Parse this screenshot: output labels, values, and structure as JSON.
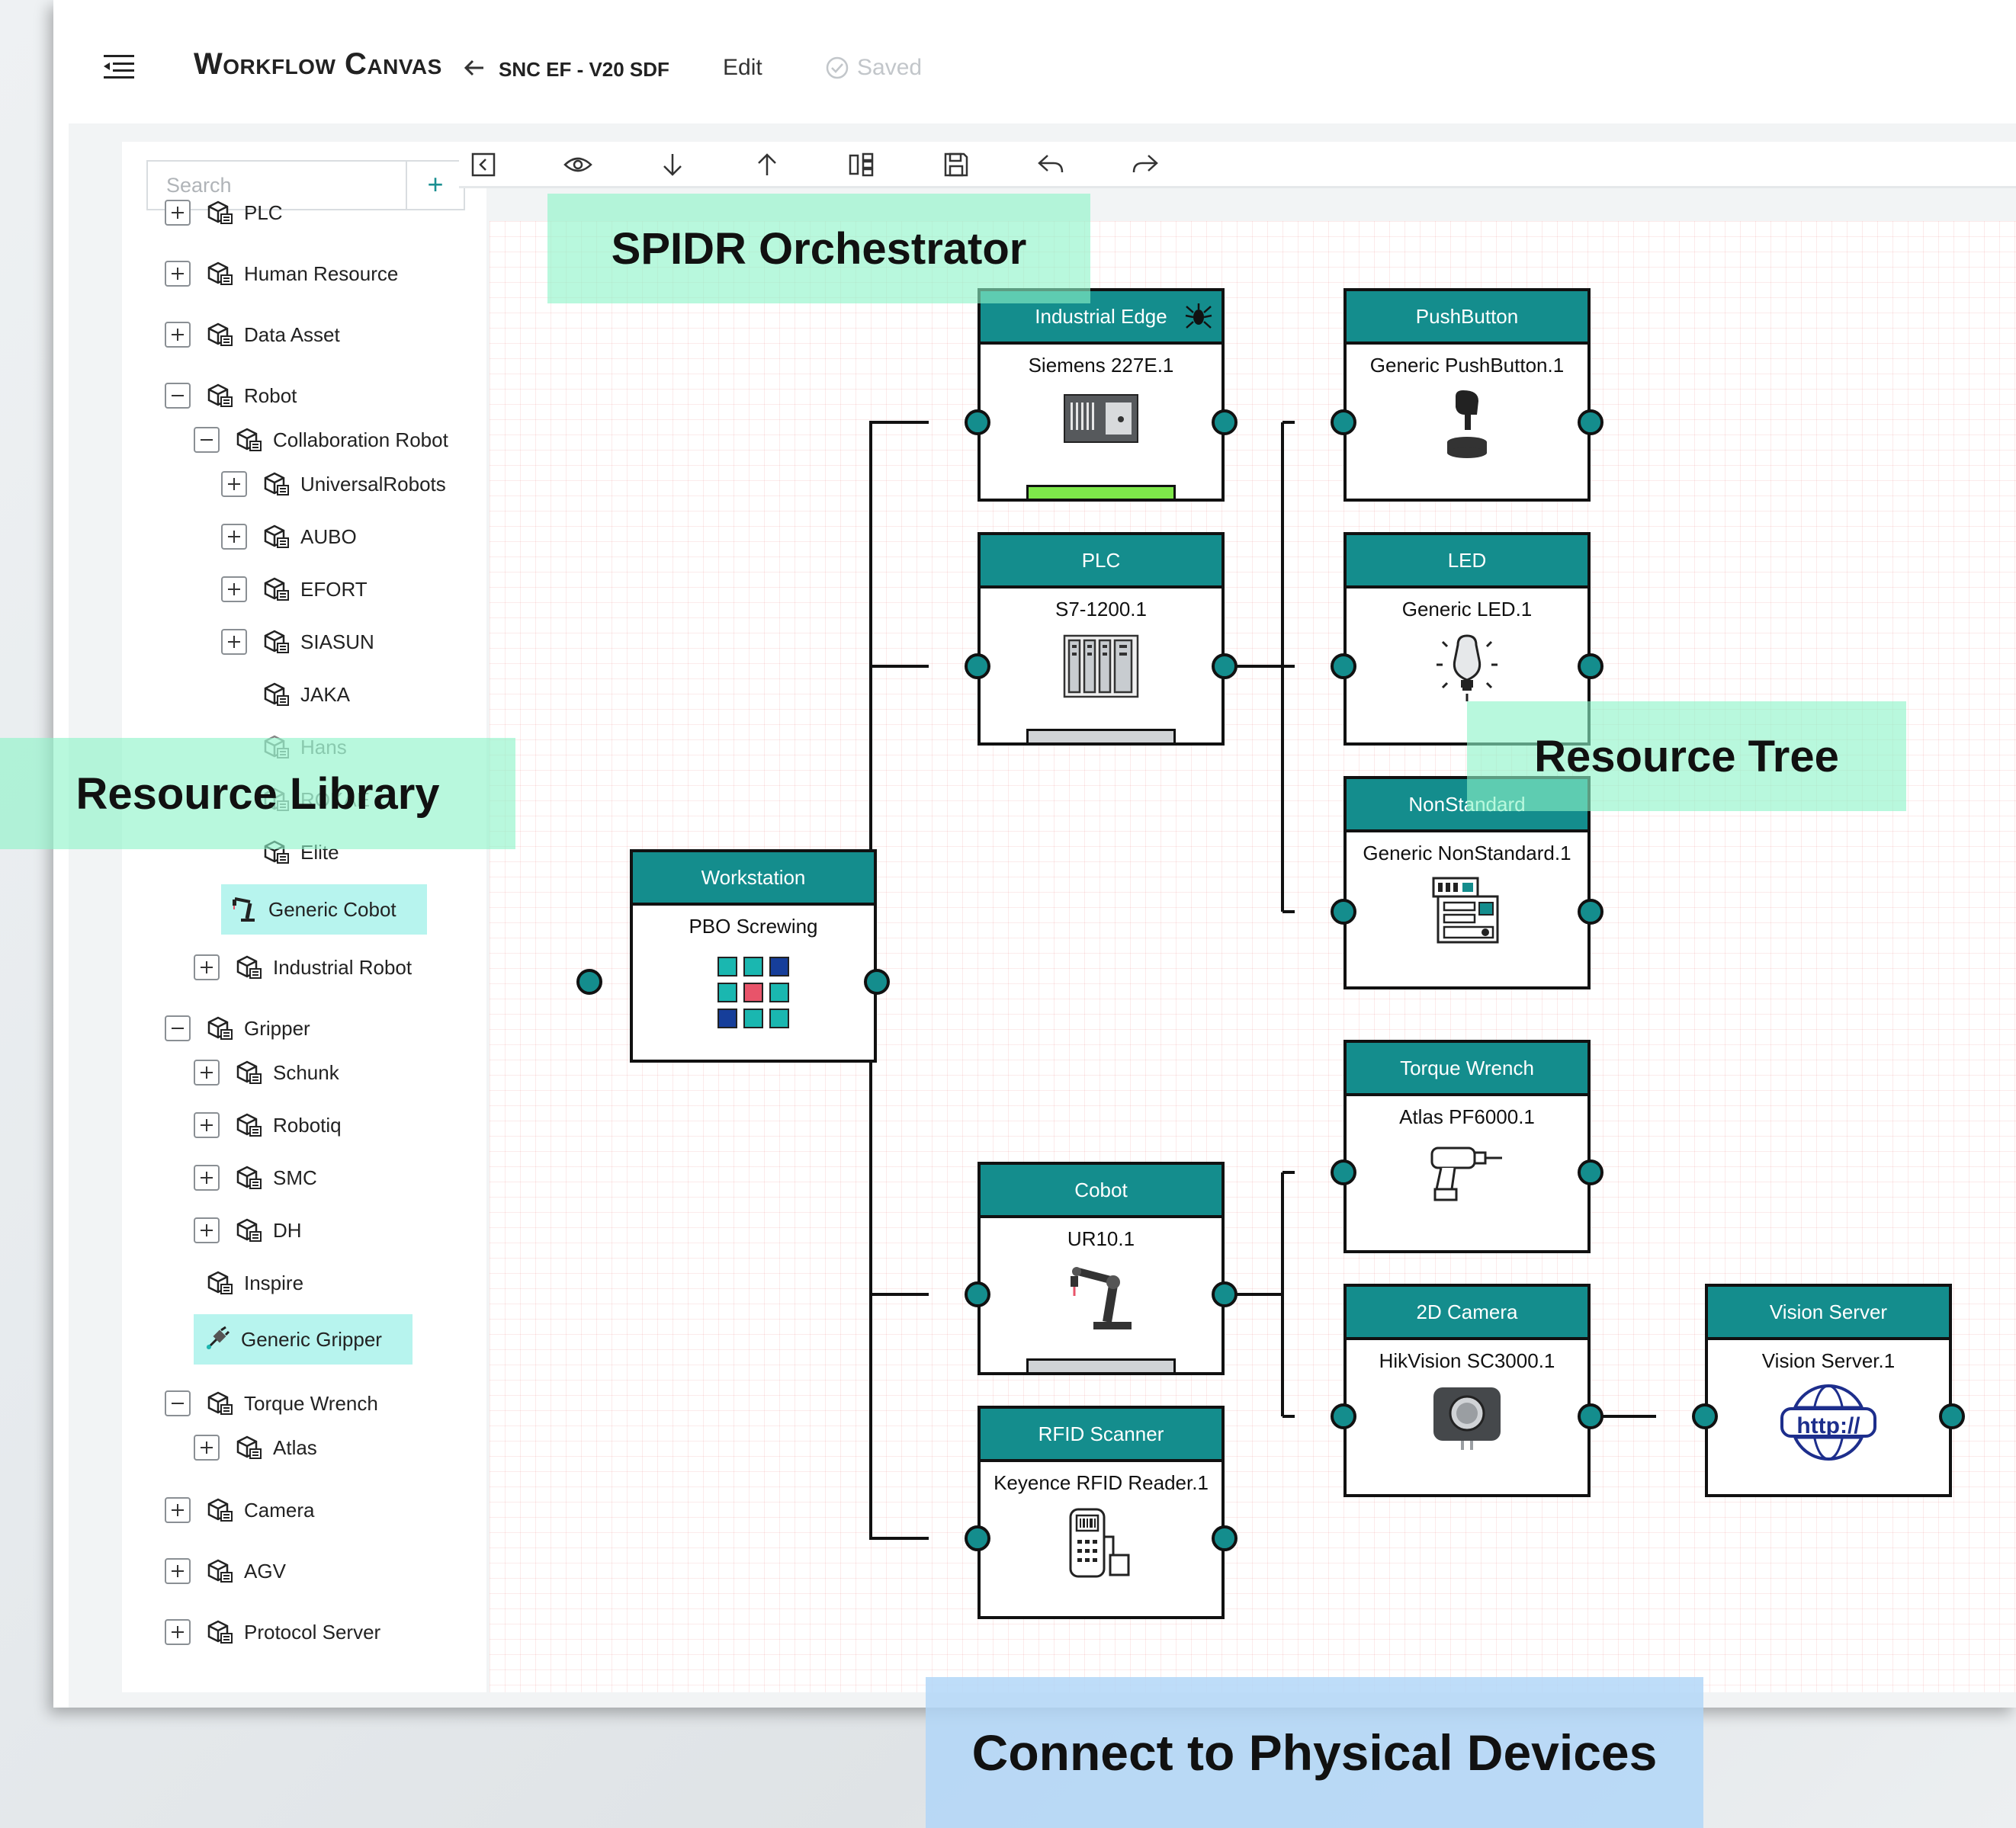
{
  "header": {
    "app_title": "Workflow Canvas",
    "project_name": "SNC EF - V20 SDF",
    "edit_label": "Edit",
    "saved_label": "Saved"
  },
  "sidebar": {
    "search_placeholder": "Search",
    "search_add": "+",
    "tree": [
      {
        "label": "PLC",
        "toggle": "plus"
      },
      {
        "label": "Human Resource",
        "toggle": "plus"
      },
      {
        "label": "Data Asset",
        "toggle": "plus"
      },
      {
        "label": "Robot",
        "toggle": "minus"
      },
      {
        "label": "Collaboration Robot",
        "toggle": "minus"
      },
      {
        "label": "UniversalRobots",
        "toggle": "plus"
      },
      {
        "label": "AUBO",
        "toggle": "plus"
      },
      {
        "label": "EFORT",
        "toggle": "plus"
      },
      {
        "label": "SIASUN",
        "toggle": "plus"
      },
      {
        "label": "JAKA",
        "toggle": "none"
      },
      {
        "label": "Hans",
        "toggle": "none"
      },
      {
        "label": "ROKAE",
        "toggle": "none"
      },
      {
        "label": "Elite",
        "toggle": "none"
      },
      {
        "label": "Generic Cobot",
        "toggle": "none",
        "highlighted": true
      },
      {
        "label": "Industrial Robot",
        "toggle": "plus"
      },
      {
        "label": "Gripper",
        "toggle": "minus"
      },
      {
        "label": "Schunk",
        "toggle": "plus"
      },
      {
        "label": "Robotiq",
        "toggle": "plus"
      },
      {
        "label": "SMC",
        "toggle": "plus"
      },
      {
        "label": "DH",
        "toggle": "plus"
      },
      {
        "label": "Inspire",
        "toggle": "none"
      },
      {
        "label": "Generic Gripper",
        "toggle": "none",
        "highlighted": true
      },
      {
        "label": "Torque Wrench",
        "toggle": "minus"
      },
      {
        "label": "Atlas",
        "toggle": "plus"
      },
      {
        "label": "Camera",
        "toggle": "plus"
      },
      {
        "label": "AGV",
        "toggle": "plus"
      },
      {
        "label": "Protocol Server",
        "toggle": "plus"
      }
    ]
  },
  "toolbar": {
    "buttons": [
      "collapse-panel-icon",
      "eye-icon",
      "arrow-down-icon",
      "arrow-up-icon",
      "layout-icon",
      "save-icon",
      "undo-icon",
      "redo-icon"
    ]
  },
  "overlays": {
    "orchestrator": "SPIDR Orchestrator",
    "library": "Resource Library",
    "tree": "Resource Tree",
    "devices": "Connect to Physical Devices"
  },
  "nodes": {
    "workstation": {
      "type": "Workstation",
      "name": "PBO Screwing"
    },
    "edge": {
      "type": "Industrial Edge",
      "name": "Siemens 227E.1"
    },
    "plc": {
      "type": "PLC",
      "name": "S7-1200.1"
    },
    "cobot": {
      "type": "Cobot",
      "name": "UR10.1"
    },
    "rfid": {
      "type": "RFID Scanner",
      "name": "Keyence RFID Reader.1"
    },
    "pushbutton": {
      "type": "PushButton",
      "name": "Generic PushButton.1"
    },
    "led": {
      "type": "LED",
      "name": "Generic LED.1"
    },
    "nonstandard": {
      "type": "NonStandard",
      "name": "Generic NonStandard.1"
    },
    "torque": {
      "type": "Torque Wrench",
      "name": "Atlas PF6000.1"
    },
    "camera": {
      "type": "2D Camera",
      "name": "HikVision SC3000.1"
    },
    "vision": {
      "type": "Vision Server",
      "name": "Vision Server.1",
      "icon_text": "http://"
    }
  },
  "colors": {
    "accent": "#148d8d",
    "overlay_green": "#a8f5d6",
    "overlay_blue": "#bcdcf8",
    "status_green": "#7ee84a"
  }
}
